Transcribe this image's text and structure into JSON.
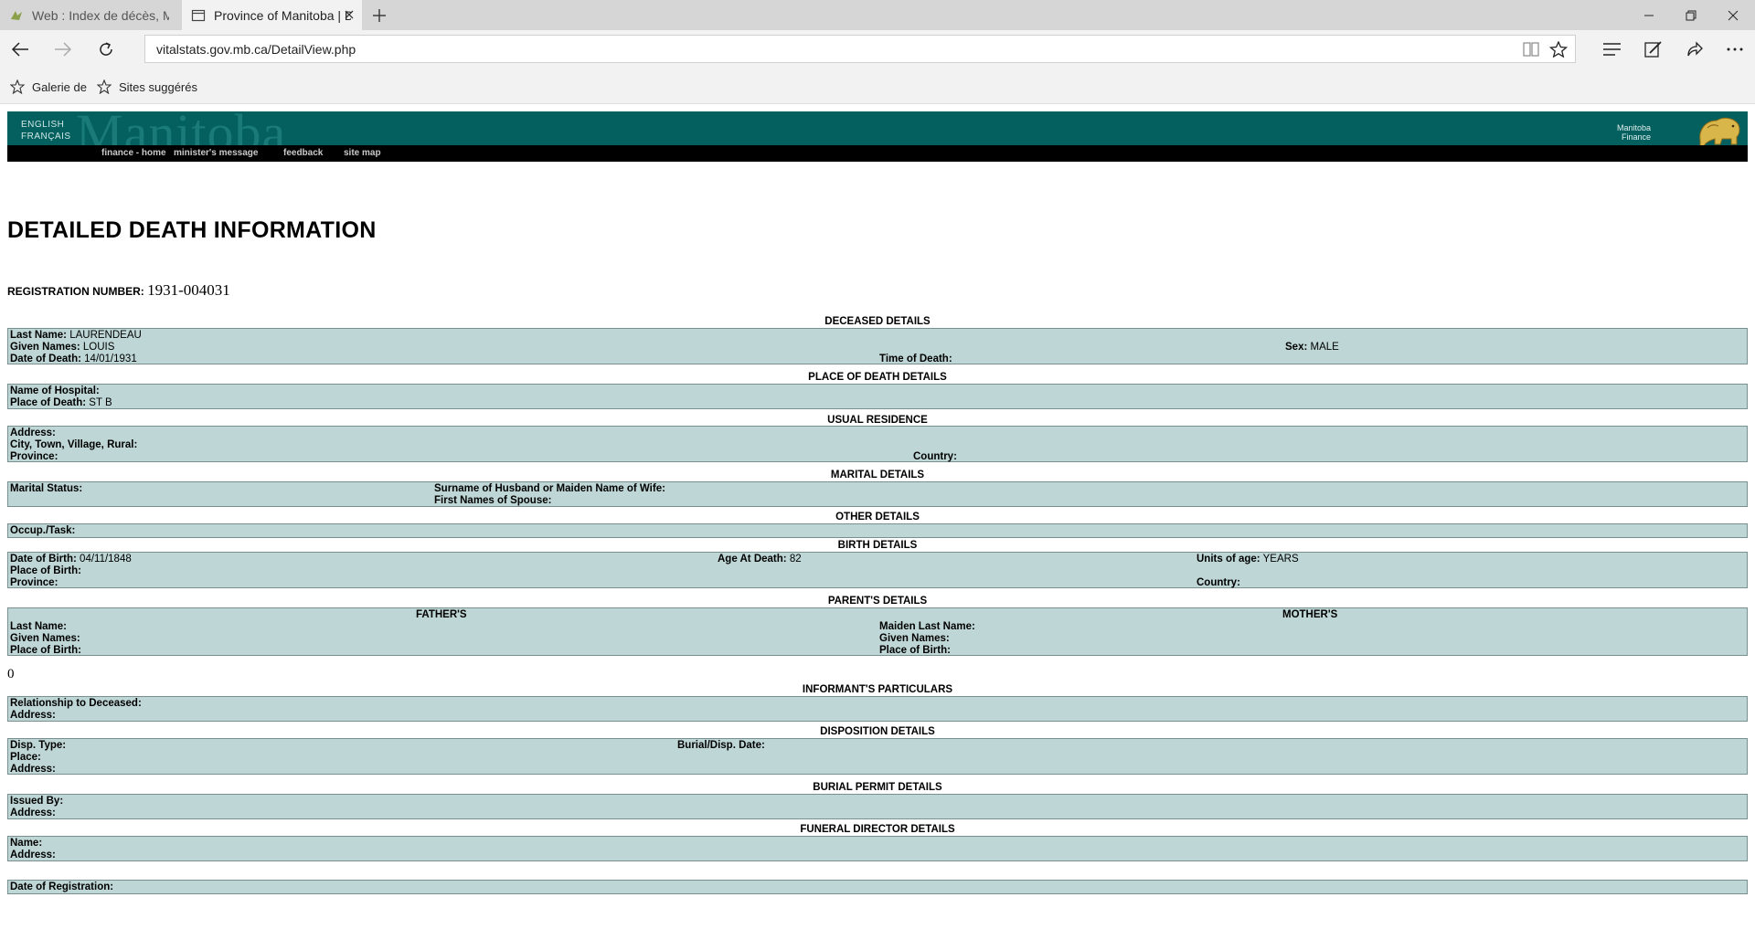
{
  "browser": {
    "tabs": [
      {
        "title": "Web : Index de décès, Mani",
        "active": false
      },
      {
        "title": "Province of Manitoba | D",
        "active": true
      }
    ],
    "url": "vitalstats.gov.mb.ca/DetailView.php",
    "favorites": [
      "Galerie de",
      "Sites suggérés"
    ]
  },
  "banner": {
    "wordmark": "Manitoba",
    "lang_en": "ENGLISH",
    "lang_fr": "FRANÇAIS",
    "dept_line1": "Manitoba",
    "dept_line2": "Finance",
    "menu": [
      "finance - home",
      "minister's message",
      "feedback",
      "site map"
    ]
  },
  "colors": {
    "banner": "#03605f",
    "panel": "#bed6d6"
  },
  "record": {
    "title": "DETAILED DEATH INFORMATION",
    "reg_label": "REGISTRATION NUMBER:",
    "reg_number": "1931-004031",
    "sections": {
      "deceased": "DECEASED DETAILS",
      "place": "PLACE OF DEATH DETAILS",
      "residence": "USUAL RESIDENCE",
      "marital": "MARITAL DETAILS",
      "other": "OTHER DETAILS",
      "birth": "BIRTH DETAILS",
      "parents": "PARENT'S DETAILS",
      "informant": "INFORMANT'S PARTICULARS",
      "disposition": "DISPOSITION DETAILS",
      "burial": "BURIAL PERMIT DETAILS",
      "funeral": "FUNERAL DIRECTOR DETAILS"
    },
    "deceased": {
      "last_name_label": "Last Name:",
      "last_name": "LAURENDEAU",
      "given_label": "Given Names:",
      "given": "LOUIS",
      "sex_label": "Sex:",
      "sex": "MALE",
      "dod_label": "Date of Death:",
      "dod": "14/01/1931",
      "tod_label": "Time of Death:"
    },
    "place": {
      "hospital_label": "Name of Hospital:",
      "pod_label": "Place of Death:",
      "pod": "ST B"
    },
    "residence": {
      "address_label": "Address:",
      "city_label": "City, Town, Village, Rural:",
      "province_label": "Province:",
      "country_label": "Country:"
    },
    "marital": {
      "status_label": "Marital Status:",
      "surname_label": "Surname of Husband or Maiden Name of Wife:",
      "spouse_label": "First Names of Spouse:"
    },
    "other": {
      "occ_label": "Occup./Task:"
    },
    "birth": {
      "dob_label": "Date of Birth:",
      "dob": "04/11/1848",
      "age_label": "Age At Death:",
      "age": "82",
      "units_label": "Units of age:",
      "units": "YEARS",
      "pob_label": "Place of Birth:",
      "province_label": "Province:",
      "country_label": "Country:"
    },
    "parents": {
      "father_head": "FATHER'S",
      "mother_head": "MOTHER'S",
      "f_last_label": "Last Name:",
      "f_given_label": "Given Names:",
      "f_pob_label": "Place of Birth:",
      "m_maiden_label": "Maiden Last Name:",
      "m_given_label": "Given Names:",
      "m_pob_label": "Place of Birth:"
    },
    "stray_value": "0",
    "informant": {
      "rel_label": "Relationship to Deceased:",
      "address_label": "Address:"
    },
    "disposition": {
      "type_label": "Disp. Type:",
      "date_label": "Burial/Disp. Date:",
      "place_label": "Place:",
      "address_label": "Address:"
    },
    "burial": {
      "issued_label": "Issued By:",
      "address_label": "Address:"
    },
    "funeral": {
      "name_label": "Name:",
      "address_label": "Address:"
    },
    "registration": {
      "date_label": "Date of Registration:"
    }
  }
}
